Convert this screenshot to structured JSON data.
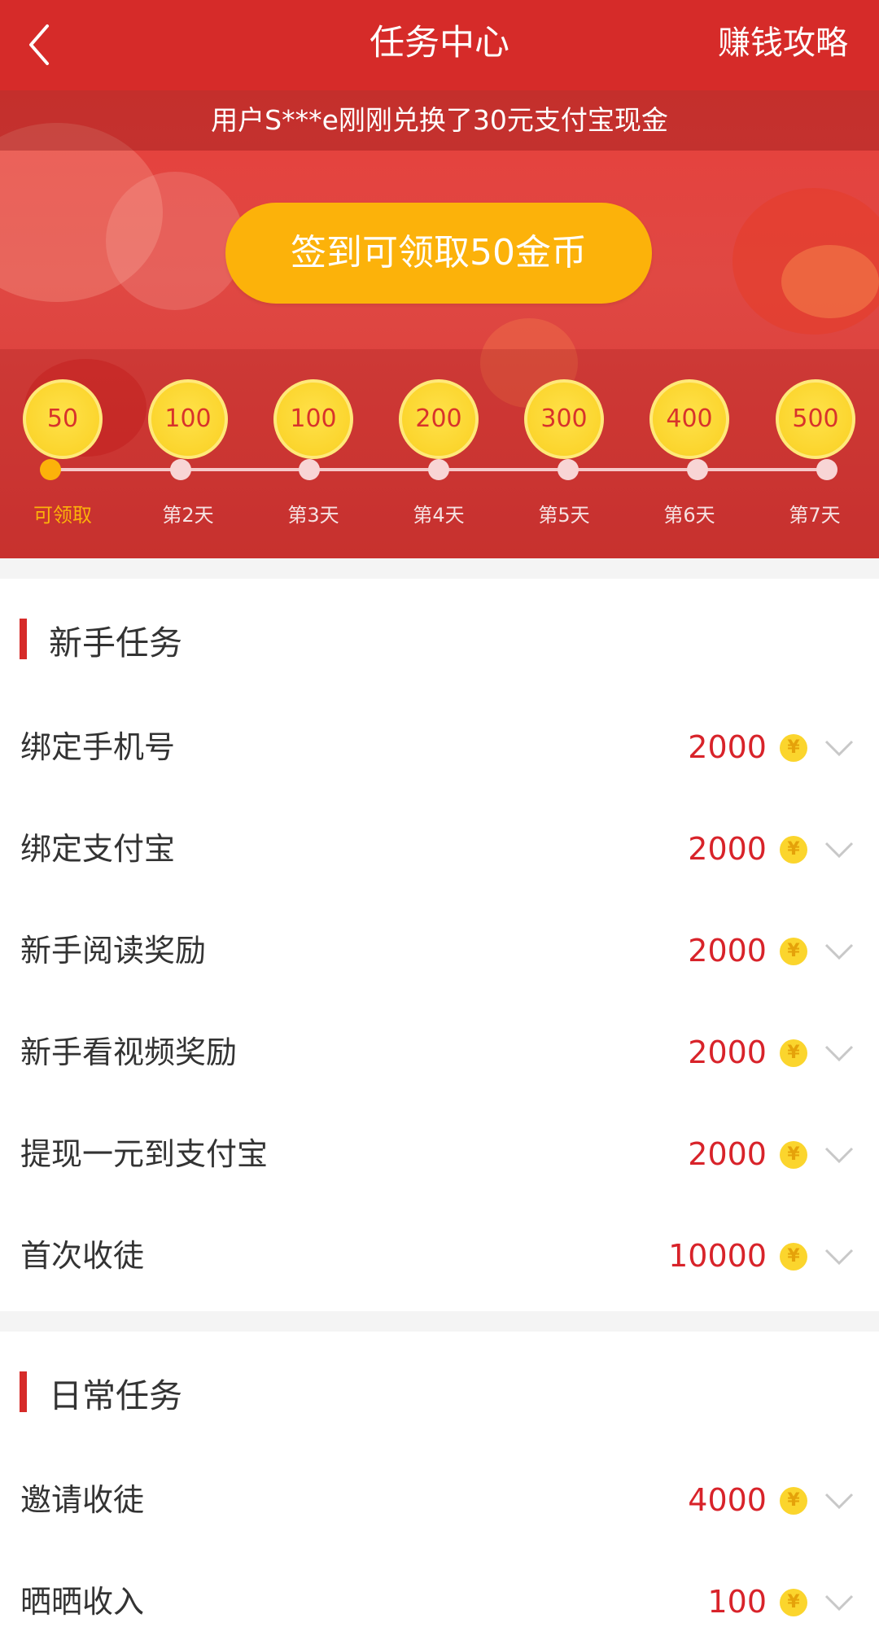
{
  "header": {
    "title": "任务中心",
    "link_label": "赚钱攻略",
    "back_icon": "chevron-left-icon"
  },
  "banner": {
    "ticker": "用户S***e刚刚兑换了30元支付宝现金",
    "signin_label": "签到可领取50金币",
    "days": [
      {
        "coins": "50",
        "label": "可领取",
        "active": true
      },
      {
        "coins": "100",
        "label": "第2天",
        "active": false
      },
      {
        "coins": "100",
        "label": "第3天",
        "active": false
      },
      {
        "coins": "200",
        "label": "第4天",
        "active": false
      },
      {
        "coins": "300",
        "label": "第5天",
        "active": false
      },
      {
        "coins": "400",
        "label": "第6天",
        "active": false
      },
      {
        "coins": "500",
        "label": "第7天",
        "active": false
      }
    ]
  },
  "newbie": {
    "title": "新手任务",
    "tasks": [
      {
        "name": "绑定手机号",
        "reward": "2000"
      },
      {
        "name": "绑定支付宝",
        "reward": "2000"
      },
      {
        "name": "新手阅读奖励",
        "reward": "2000"
      },
      {
        "name": "新手看视频奖励",
        "reward": "2000"
      },
      {
        "name": "提现一元到支付宝",
        "reward": "2000"
      },
      {
        "name": "首次收徒",
        "reward": "10000"
      }
    ]
  },
  "daily": {
    "title": "日常任务",
    "tasks": [
      {
        "name": "邀请收徒",
        "reward": "4000"
      },
      {
        "name": "晒晒收入",
        "reward": "100"
      }
    ]
  },
  "coin_symbol": "¥",
  "colors": {
    "header_red": "#d62b29",
    "accent_yellow": "#fcb20a",
    "reward_red": "#d8232a"
  }
}
